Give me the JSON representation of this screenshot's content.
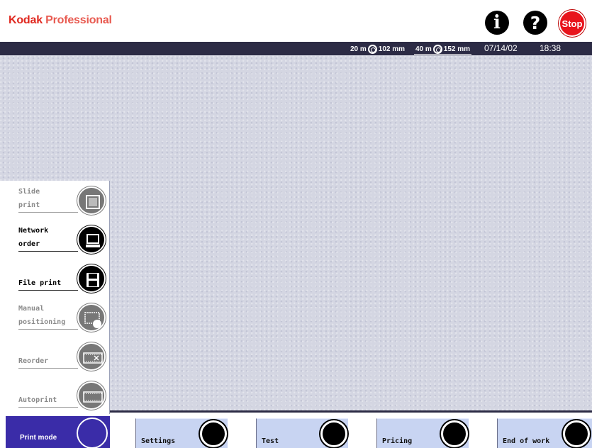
{
  "header": {
    "brand": "Kodak",
    "product": "Professional",
    "info_glyph": "i",
    "help_glyph": "?",
    "stop_label": "Stop"
  },
  "status": {
    "roll1_length": "20 m",
    "roll1_width": "102 mm",
    "roll2_length": "40 m",
    "roll2_width": "152 mm",
    "date": "07/14/02",
    "time": "18:38"
  },
  "mode_menu": {
    "items": [
      {
        "line1": "Slide",
        "line2": "print",
        "enabled": false,
        "icon": "slide-icon"
      },
      {
        "line1": "Network",
        "line2": "order",
        "enabled": true,
        "icon": "computer-icon"
      },
      {
        "line1": "",
        "line2": "File print",
        "enabled": true,
        "icon": "floppy-disk-icon"
      },
      {
        "line1": "Manual",
        "line2": "positioning",
        "enabled": false,
        "icon": "hand-frame-icon"
      },
      {
        "line1": "",
        "line2": "Reorder",
        "enabled": false,
        "icon": "film-strip-x-icon"
      },
      {
        "line1": "",
        "line2": "Autoprint",
        "enabled": false,
        "icon": "film-strip-icon"
      }
    ],
    "print_mode_label": "Print mode"
  },
  "tabs": [
    {
      "label": "Settings"
    },
    {
      "label": "Test"
    },
    {
      "label": "Pricing"
    },
    {
      "label": "End of work"
    }
  ],
  "colors": {
    "brand_red": "#e0281f",
    "status_bar": "#2c2b45",
    "print_mode_bg": "#3a2ca8",
    "tab_bg": "#c8d4f2",
    "workspace": "#d4d6e2"
  }
}
